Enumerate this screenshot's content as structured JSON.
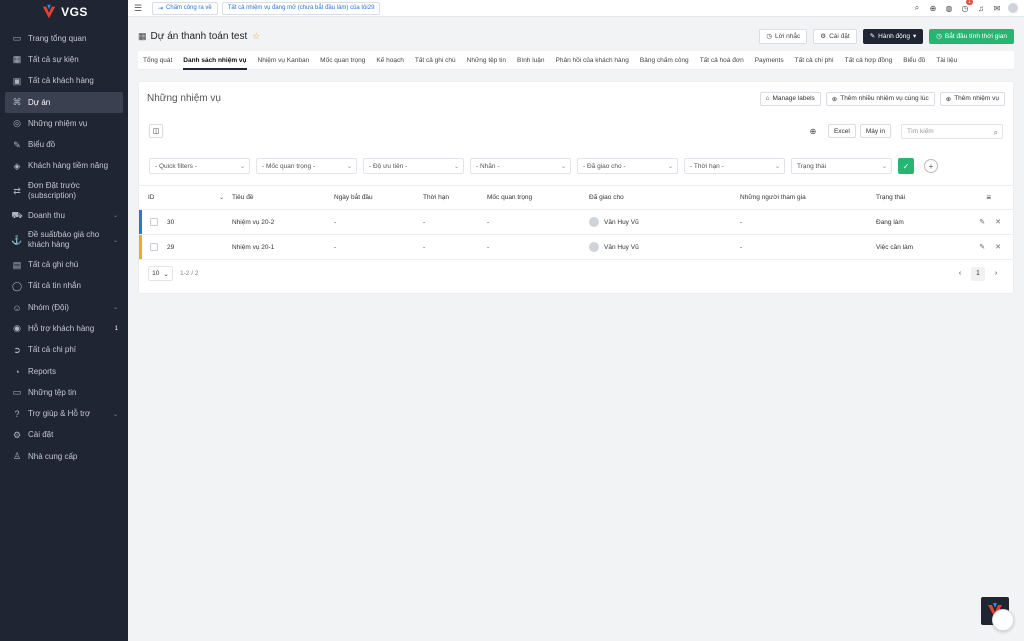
{
  "brand": {
    "name": "VGS"
  },
  "sidebar": {
    "items": [
      {
        "label": "Trang tổng quan",
        "icon": "monitor-icon",
        "glyph": "▭"
      },
      {
        "label": "Tất cả sự kiện",
        "icon": "calendar-icon",
        "glyph": "▦"
      },
      {
        "label": "Tất cả khách hàng",
        "icon": "briefcase-icon",
        "glyph": "▣"
      },
      {
        "label": "Dự án",
        "icon": "command-icon",
        "glyph": "⌘",
        "active": true
      },
      {
        "label": "Những nhiệm vụ",
        "icon": "check-circle-icon",
        "glyph": "◎"
      },
      {
        "label": "Biểu đồ",
        "icon": "pen-icon",
        "glyph": "✎"
      },
      {
        "label": "Khách hàng tiềm năng",
        "icon": "layers-icon",
        "glyph": "◈"
      },
      {
        "label": "Đơn Đặt trước (subscription)",
        "icon": "repeat-icon",
        "glyph": "⇄",
        "tall": true
      },
      {
        "label": "Doanh thu",
        "icon": "cart-icon",
        "glyph": "⛟",
        "chevron": "⌄"
      },
      {
        "label": "Đề suất/báo giá cho khách hàng",
        "icon": "anchor-icon",
        "glyph": "⚓",
        "tall": true,
        "chevron": "⌄"
      },
      {
        "label": "Tất cả ghi chú",
        "icon": "book-icon",
        "glyph": "▤"
      },
      {
        "label": "Tất cả tin nhắn",
        "icon": "message-icon",
        "glyph": "◯"
      },
      {
        "label": "Nhóm (Đội)",
        "icon": "users-icon",
        "glyph": "☺",
        "chevron": "⌄"
      },
      {
        "label": "Hỗ trợ khách hàng",
        "icon": "lifebuoy-icon",
        "glyph": "◉",
        "badge": "1"
      },
      {
        "label": "Tất cả chi phí",
        "icon": "arrow-circle-icon",
        "glyph": "➲"
      },
      {
        "label": "Reports",
        "icon": "pie-icon",
        "glyph": "◔"
      },
      {
        "label": "Những tệp tin",
        "icon": "folder-icon",
        "glyph": "▭"
      },
      {
        "label": "Trợ giúp & Hỗ trợ",
        "icon": "help-icon",
        "glyph": "?",
        "chevron": "⌄"
      },
      {
        "label": "Cài đặt",
        "icon": "settings-icon",
        "glyph": "⚙"
      },
      {
        "label": "Nhà cung cấp",
        "icon": "user-icon",
        "glyph": "♙"
      }
    ]
  },
  "topbar": {
    "clock_out": "Chấm công ra về",
    "task_notice": "Tất cả nhiệm vụ đang mở (chưa bắt đầu làm) của tôi29",
    "notif_count": "1"
  },
  "title": {
    "text": "Dự án thanh toán test",
    "reminder": "Lời nhắc",
    "settings": "Cài đặt",
    "actions": "Hành động",
    "start_timer": "Bắt đầu tính thời gian"
  },
  "tabs": [
    "Tổng quát",
    "Danh sách nhiệm vụ",
    "Nhiệm vụ Kanban",
    "Mốc quan trọng",
    "Kế hoạch",
    "Tất cả ghi chú",
    "Những tệp tin",
    "Bình luận",
    "Phản hồi của khách hàng",
    "Bảng chấm công",
    "Tất cả hoá đơn",
    "Payments",
    "Tất cả chi phí",
    "Tất cả hợp đồng",
    "Biểu đồ",
    "Tài liệu"
  ],
  "active_tab": 1,
  "card": {
    "title": "Những nhiệm vụ",
    "manage_labels": "Manage labels",
    "add_multiple": "Thêm nhiều nhiệm vụ cùng lúc",
    "add_task": "Thêm nhiệm vụ",
    "excel": "Excel",
    "print": "Máy in",
    "search_placeholder": "Tìm kiếm"
  },
  "filters": [
    "- Quick filters -",
    "- Mốc quan trọng -",
    "- Độ ưu tiên -",
    "- Nhãn -",
    "- Đã giao cho -",
    "- Thời hạn -",
    "Trạng thái"
  ],
  "table": {
    "headers": {
      "id": "ID",
      "title": "Tiêu đề",
      "start": "Ngày bắt đầu",
      "deadline": "Thời hạn",
      "milestone": "Mốc quan trọng",
      "assigned": "Đã giao cho",
      "collaborators": "Những người tham gia",
      "status": "Trạng thái"
    },
    "rows": [
      {
        "id": "30",
        "title": "Nhiệm vụ 20-2",
        "start": "-",
        "deadline": "-",
        "milestone": "-",
        "assigned": "Văn Huy Vũ",
        "collaborators": "-",
        "status": "Đang làm",
        "bar_color": "#2d74d8"
      },
      {
        "id": "29",
        "title": "Nhiệm vụ 20-1",
        "start": "-",
        "deadline": "-",
        "milestone": "-",
        "assigned": "Văn Huy Vũ",
        "collaborators": "-",
        "status": "Việc cần làm",
        "bar_color": "#f5a623"
      }
    ]
  },
  "pager": {
    "page_size": "10",
    "info": "1-2 / 2",
    "current": "1"
  }
}
